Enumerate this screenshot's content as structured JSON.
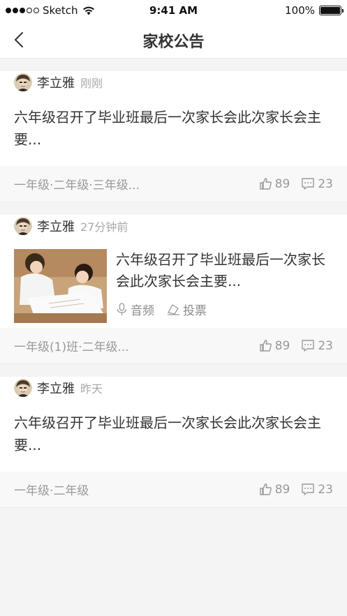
{
  "status_bar": {
    "carrier": "Sketch",
    "time": "9:41 AM",
    "battery": "100%"
  },
  "nav": {
    "title": "家校公告"
  },
  "posts": [
    {
      "author": "李立雅",
      "time": "刚刚",
      "content": "六年级召开了毕业班最后一次家长会此次家长会主要...",
      "audience": "一年级·二年级·三年级...",
      "likes": "89",
      "comments": "23"
    },
    {
      "author": "李立雅",
      "time": "27分钟前",
      "content": "六年级召开了毕业班最后一次家长会此次家长会主要...",
      "tags": [
        "音频",
        "投票"
      ],
      "audience": "一年级(1)班·二年级...",
      "likes": "89",
      "comments": "23"
    },
    {
      "author": "李立雅",
      "time": "昨天",
      "content": "六年级召开了毕业班最后一次家长会此次家长会主要...",
      "audience": "一年级·二年级",
      "likes": "89",
      "comments": "23"
    }
  ]
}
